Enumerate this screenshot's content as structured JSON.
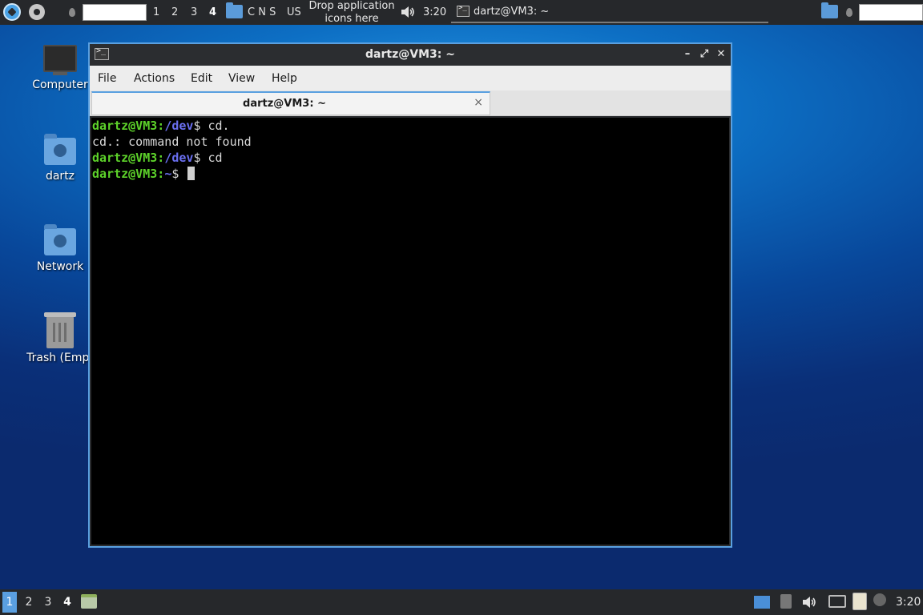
{
  "top_panel": {
    "workspaces": [
      "1",
      "2",
      "3",
      "4"
    ],
    "active_workspace": "4",
    "keyboard_layouts": "C N S",
    "keyboard_lang": "US",
    "drop_text": "Drop application icons here",
    "clock": "3:20",
    "task_title": "dartz@VM3: ~"
  },
  "desktop": {
    "icons": [
      {
        "label": "Computer"
      },
      {
        "label": "dartz"
      },
      {
        "label": "Network"
      },
      {
        "label": "Trash (Empt"
      }
    ]
  },
  "window": {
    "title": "dartz@VM3: ~",
    "menu": [
      "File",
      "Actions",
      "Edit",
      "View",
      "Help"
    ],
    "tab_label": "dartz@VM3: ~",
    "tab_close": "×",
    "terminal": {
      "line1": {
        "user": "dartz@VM3",
        "colon": ":",
        "path": "/dev",
        "prompt": "$ ",
        "cmd": "cd."
      },
      "line2": "cd.: command not found",
      "line3": {
        "user": "dartz@VM3",
        "colon": ":",
        "path": "/dev",
        "prompt": "$ ",
        "cmd": "cd"
      },
      "line4": {
        "user": "dartz@VM3",
        "colon": ":",
        "path": "~",
        "prompt": "$ ",
        "cmd": ""
      }
    }
  },
  "bottom_panel": {
    "workspaces": [
      "1",
      "2",
      "3",
      "4"
    ],
    "active_workspace": "1",
    "clock": "3:20"
  },
  "colors": {
    "user_prompt": "#5dd22a",
    "path": "#6a6ff0",
    "accent": "#5aa0e0",
    "panel": "#26282b"
  }
}
